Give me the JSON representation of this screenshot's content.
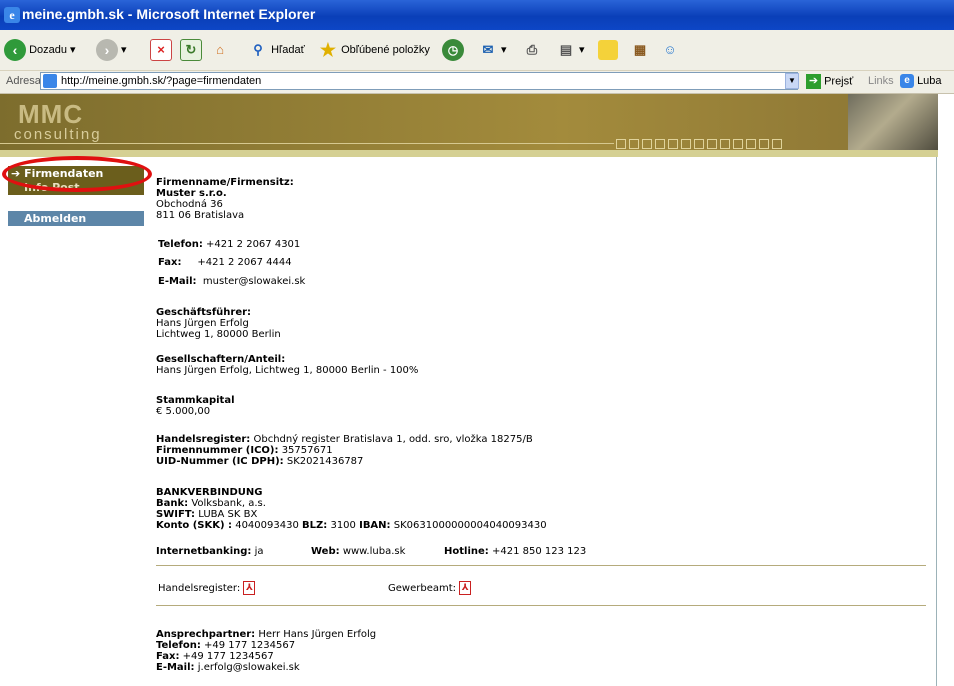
{
  "window": {
    "title": "meine.gmbh.sk - Microsoft Internet Explorer"
  },
  "toolbar": {
    "back": "Dozadu",
    "search": "Hľadať",
    "favorites": "Obľúbené položky"
  },
  "address": {
    "label": "Adresa",
    "url": "http://meine.gmbh.sk/?page=firmendaten",
    "go": "Prejsť",
    "links": "Links",
    "luba": "Luba"
  },
  "banner": {
    "logo": "MMC",
    "sub": "consulting"
  },
  "nav": [
    "Firmendaten",
    "Info Post",
    "Abmelden"
  ],
  "company": {
    "heading": "Firmenname/Firmensitz:",
    "name": "Muster s.r.o.",
    "street": "Obchodná 36",
    "city": "811 06 Bratislava"
  },
  "contact": {
    "tel_label": "Telefon:",
    "tel": "+421 2 2067 4301",
    "fax_label": "Fax:",
    "fax": "+421 2 2067 4444",
    "email_label": "E-Mail:",
    "email": "muster@slowakei.sk"
  },
  "manager": {
    "heading": "Geschäftsführer:",
    "name": "Hans Jürgen Erfolg",
    "addr": "Lichtweg 1, 80000 Berlin"
  },
  "partners": {
    "heading": "Gesellschaftern/Anteil:",
    "text": "Hans Jürgen Erfolg, Lichtweg 1, 80000 Berlin - 100%"
  },
  "capital": {
    "heading": "Stammkapital",
    "value": "€ 5.000,00"
  },
  "register": {
    "hr_label": "Handelsregister:",
    "hr": "Obchdný register Bratislava 1, odd. sro, vložka 18275/B",
    "ico_label": "Firmennummer (ICO):",
    "ico": "35757671",
    "uid_label": "UID-Nummer (IC DPH):",
    "uid": "SK2021436787"
  },
  "bank": {
    "heading": "BANKVERBINDUNG",
    "bank_label": "Bank:",
    "bank": "Volksbank, a.s.",
    "swift_label": "SWIFT:",
    "swift": "LUBA SK BX",
    "konto_label": "Konto (SKK) :",
    "konto": "4040093430",
    "blz_label": "BLZ:",
    "blz": "3100",
    "iban_label": "IBAN:",
    "iban": "SK0631000000004040093430"
  },
  "online": {
    "ib_label": "Internetbanking:",
    "ib": "ja",
    "web_label": "Web:",
    "web": "www.luba.sk",
    "hotline_label": "Hotline:",
    "hotline": "+421 850 123 123"
  },
  "docs": {
    "hr": "Handelsregister:",
    "gew": "Gewerbeamt:"
  },
  "person": {
    "ap_label": "Ansprechpartner:",
    "ap": "Herr Hans Jürgen Erfolg",
    "tel_label": "Telefon:",
    "tel": "+49 177 1234567",
    "fax_label": "Fax:",
    "fax": "+49 177 1234567",
    "email_label": "E-Mail:",
    "email": "j.erfolg@slowakei.sk"
  }
}
